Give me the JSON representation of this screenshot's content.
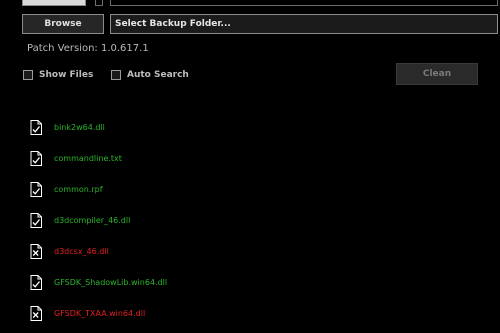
{
  "toolbar": {
    "browse_label": "Browse",
    "backup_folder_label": "Select Backup Folder..."
  },
  "patch_version": "Patch Version: 1.0.617.1",
  "options": {
    "show_files_label": "Show Files",
    "show_files_checked": false,
    "auto_search_label": "Auto Search",
    "auto_search_checked": false,
    "clean_label": "Clean"
  },
  "colors": {
    "ok": "#2bb42b",
    "missing": "#e02020",
    "icon": "#ffffff"
  },
  "files": [
    {
      "name": "bink2w64.dll",
      "status": "ok",
      "icon": "file-check-icon"
    },
    {
      "name": "commandline.txt",
      "status": "ok",
      "icon": "file-check-icon"
    },
    {
      "name": "common.rpf",
      "status": "ok",
      "icon": "file-check-icon"
    },
    {
      "name": "d3dcompiler_46.dll",
      "status": "ok",
      "icon": "file-check-icon"
    },
    {
      "name": "d3dcsx_46.dll",
      "status": "missing",
      "icon": "file-x-icon"
    },
    {
      "name": "GFSDK_ShadowLib.win64.dll",
      "status": "ok",
      "icon": "file-check-icon"
    },
    {
      "name": "GFSDK_TXAA.win64.dll",
      "status": "missing",
      "icon": "file-x-icon"
    }
  ]
}
